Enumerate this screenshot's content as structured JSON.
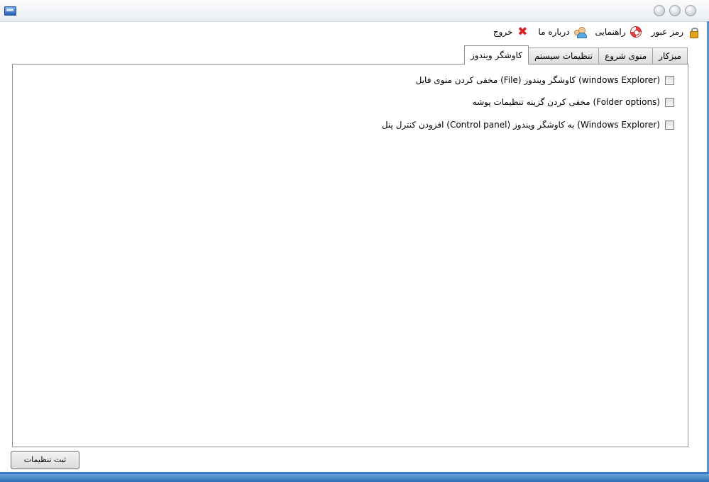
{
  "window": {
    "title": "",
    "buttons": [
      "minimize",
      "maximize",
      "close"
    ]
  },
  "menu": {
    "items": [
      {
        "label": "رمز عبور",
        "icon": "lock-icon"
      },
      {
        "label": "راهنمایی",
        "icon": "lifebuoy-icon"
      },
      {
        "label": "درباره ما",
        "icon": "users-icon"
      },
      {
        "label": "خروج",
        "icon": "red-x-icon"
      }
    ]
  },
  "tabs": [
    {
      "label": "میزکار",
      "active": false
    },
    {
      "label": "منوی شروع",
      "active": false
    },
    {
      "label": "تنظیمات سیستم",
      "active": false
    },
    {
      "label": "کاوشگر ویندوز",
      "active": true
    }
  ],
  "options": [
    {
      "label": "مخفی کردن منوی فایل (File) کاوشگر ویندوز (windows Explorer)",
      "checked": false
    },
    {
      "label": "مخفی کردن گزینه تنظیمات پوشه (Folder options)",
      "checked": false
    },
    {
      "label": "افزودن کنترل پنل (Control panel) به کاوشگر ویندوز (Windows Explorer)",
      "checked": false
    }
  ],
  "footer": {
    "save_label": "ثبت تنظیمات"
  },
  "colors": {
    "accent": "#3a78c9"
  }
}
